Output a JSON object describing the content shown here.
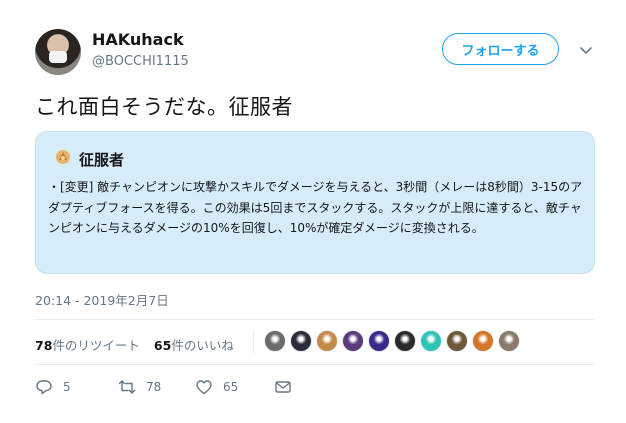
{
  "user": {
    "display_name": "HAKuhack",
    "handle": "@BOCCHI1115",
    "follow_label": "フォローする"
  },
  "tweet": {
    "text": "これ面白そうだな。征服者",
    "timestamp": "20:14 - 2019年2月7日"
  },
  "quote_card": {
    "title": "征服者",
    "body": "・[変更] 敵チャンピオンに攻撃かスキルでダメージを与えると、3秒間（メレーは8秒間）3-15のアダプティブフォースを得る。この効果は5回までスタックする。スタックが上限に達すると、敵チャンピオンに与えるダメージの10%を回復し、10%が確定ダメージに変換される。"
  },
  "stats": {
    "retweet_count": "78",
    "retweet_label": "件のリツイート",
    "like_count": "65",
    "like_label": "件のいいね"
  },
  "actions": {
    "reply_count": "5",
    "retweet_count": "78",
    "like_count": "65"
  },
  "likers": [
    "#6b6b6b",
    "#2b2b3a",
    "#c48a4a",
    "#5a3a7a",
    "#3a2a8a",
    "#2a2a2a",
    "#2ec4b6",
    "#6a5a3a",
    "#d4762a",
    "#8a7a6a"
  ]
}
